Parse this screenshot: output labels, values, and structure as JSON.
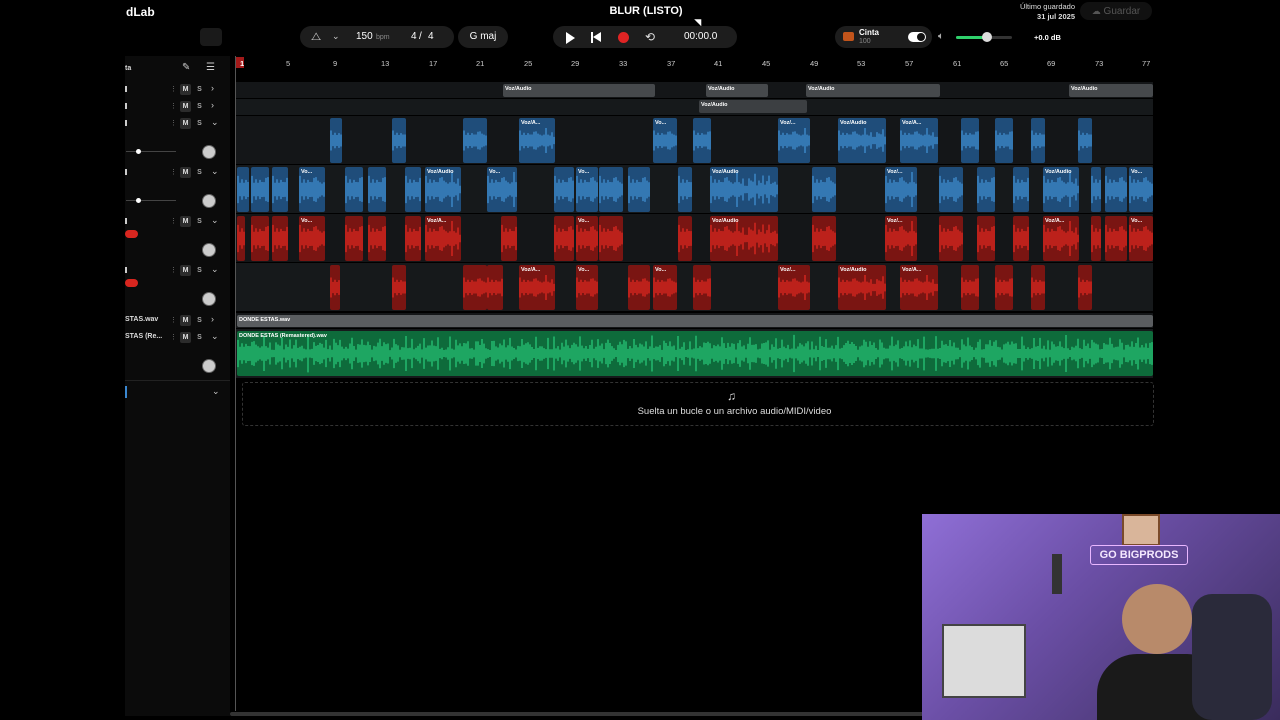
{
  "app": {
    "brand": "dLab",
    "project_title": "BLUR (LISTO)",
    "save_status_line1": "Último guardado",
    "save_status_line2": "31 jul 2025",
    "save_button": "Guardar"
  },
  "transport": {
    "bpm": "150",
    "bpm_unit": "bpm",
    "time_sig_num": "4",
    "time_sig_sep": "/",
    "time_sig_den": "4",
    "key": "G maj",
    "time": "00:00.0",
    "tape_label": "Cinta",
    "tape_value": "100",
    "volume_db": "+0.0 dB",
    "volume_level": 0.55
  },
  "tracks_panel": {
    "header_label": "ta",
    "tracks": [
      {
        "name": "",
        "ms": [
          "M",
          "S"
        ]
      },
      {
        "name": "",
        "ms": [
          "M",
          "S"
        ]
      },
      {
        "name": "",
        "ms": [
          "M",
          "S"
        ]
      },
      {
        "name": "",
        "ms": [
          "M",
          "S"
        ]
      },
      {
        "name": "",
        "ms": [
          "M",
          "S"
        ]
      },
      {
        "name": "",
        "ms": [
          "M",
          "S"
        ]
      },
      {
        "name": "STAS.wav",
        "ms": [
          "M",
          "S"
        ]
      },
      {
        "name": "STAS (Re...",
        "ms": [
          "M",
          "S"
        ]
      }
    ]
  },
  "ruler": {
    "bars": [
      "1",
      "5",
      "9",
      "13",
      "17",
      "21",
      "25",
      "29",
      "33",
      "37",
      "41",
      "45",
      "49",
      "53",
      "57",
      "61",
      "65",
      "69",
      "73",
      "77"
    ]
  },
  "clips": {
    "voz_audio": "Voz/Audio",
    "voz_short": "Voz/...",
    "vo": "Vo...",
    "voz_a": "Voz/A...",
    "donde_estas": "DONDE ESTAS.wav",
    "donde_estas_remastered": "DONDE ESTAS (Remastered).wav"
  },
  "drop_zone": {
    "text": "Suelta un bucle o un archivo audio/MIDI/video"
  },
  "webcam": {
    "neon_sign": "GO BIGPRODS"
  },
  "colors": {
    "blue_clip": "#3a87d0",
    "red_clip": "#d8261f",
    "green_clip": "#1fb86a",
    "gray_clip": "#3c3f42"
  }
}
